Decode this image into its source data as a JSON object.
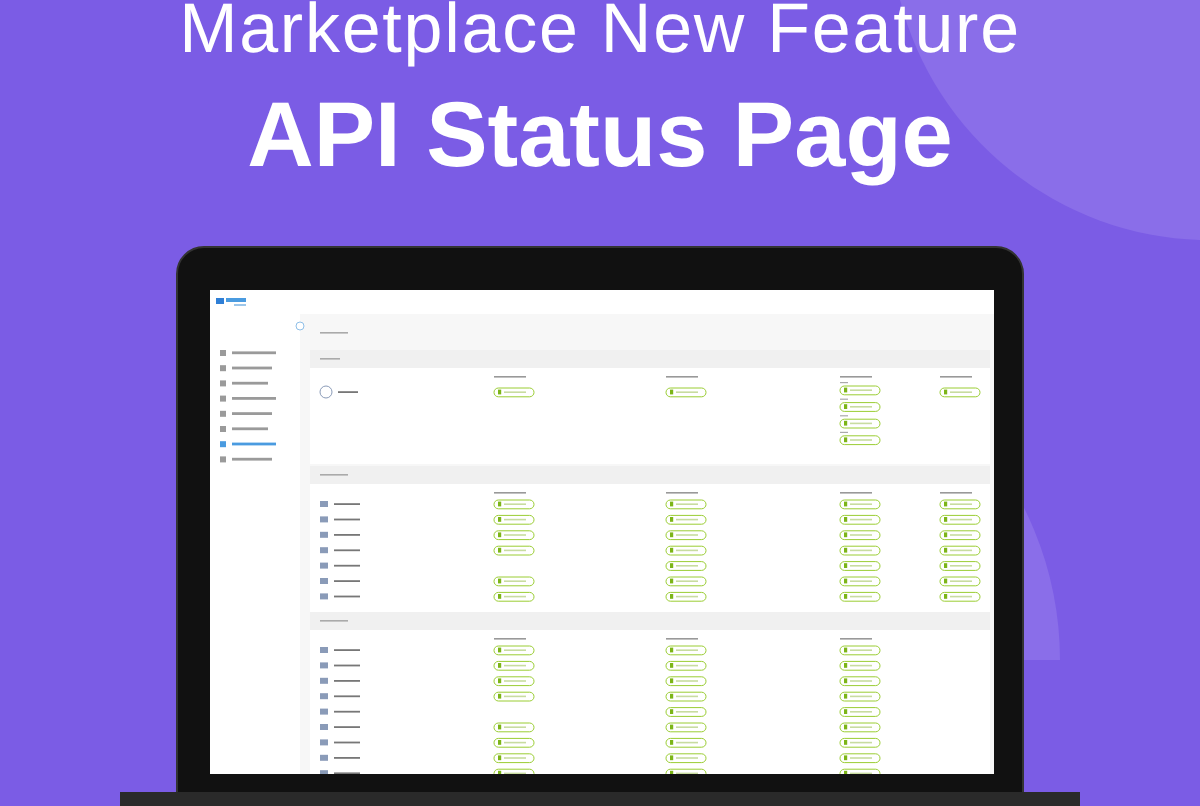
{
  "headline": {
    "kicker": "Marketplace New Feature",
    "title": "API Status Page"
  }
}
